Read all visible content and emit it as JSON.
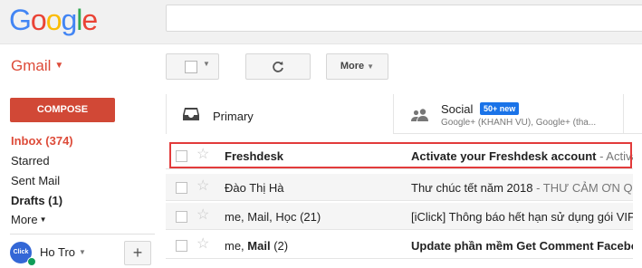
{
  "logo": {
    "g": "G",
    "o1": "o",
    "o2": "o",
    "g2": "g",
    "l": "l",
    "e": "e"
  },
  "gmail_label": "Gmail",
  "toolbar": {
    "more_label": "More"
  },
  "compose_label": "COMPOSE",
  "nav": {
    "inbox": "Inbox (374)",
    "starred": "Starred",
    "sent": "Sent Mail",
    "drafts": "Drafts (1)",
    "more": "More"
  },
  "hangouts": {
    "avatar_text": "Click",
    "name": "Ho Tro",
    "add": "+"
  },
  "tabs": {
    "primary": {
      "label": "Primary"
    },
    "social": {
      "label": "Social",
      "badge": "50+ new",
      "sub": "Google+ (KHANH VU), Google+ (tha..."
    }
  },
  "emails": [
    {
      "sender": "Freshdesk",
      "subject": "Activate your Freshdesk account",
      "snippet": " - Activate",
      "unread": true
    },
    {
      "sender": "Đào Thị Hà",
      "subject": "Thư chúc tết năm 2018",
      "snippet": " - THƯ CẢM ƠN QUÝ",
      "unread": false
    },
    {
      "sender": "me, Mail, Học (21)",
      "subject": "[iClick] Thông báo hết hạn sử dụng gói VIP",
      "snippet": " -",
      "unread": false
    },
    {
      "sender_a": "me, ",
      "sender_b": "Mail",
      "sender_c": " (2)",
      "subject": "Update phần mềm Get Comment Faceboo",
      "snippet": "",
      "unread": true
    }
  ],
  "colors": {
    "gmail_red": "#dd4b39",
    "compose": "#d14836",
    "badge": "#1a73e8",
    "highlight": "#e23b3b"
  }
}
